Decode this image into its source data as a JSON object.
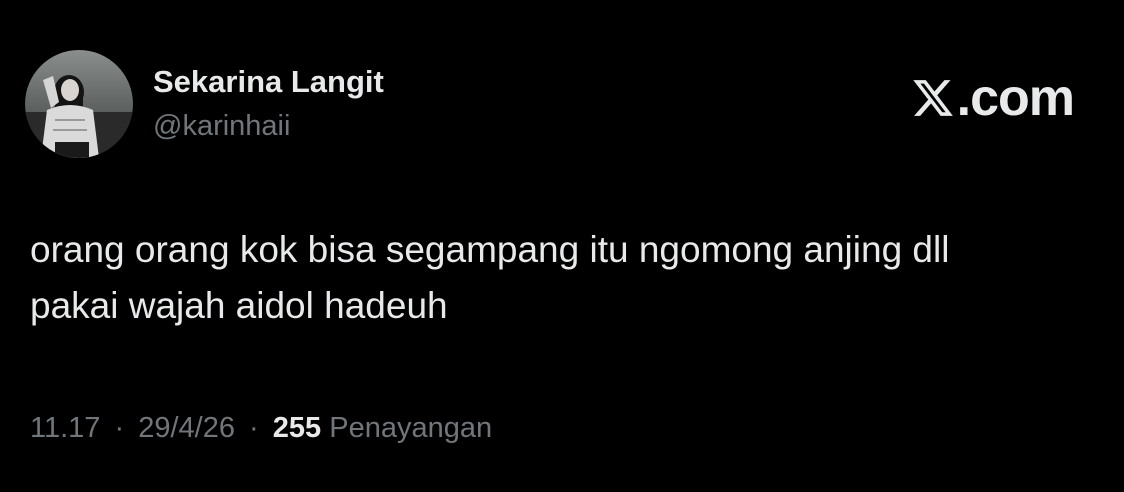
{
  "author": {
    "display_name": "Sekarina Langit",
    "handle": "@karinhaii"
  },
  "brand": {
    "logo_icon": "x-logo-icon",
    "domain": ".com"
  },
  "tweet": {
    "lines": [
      "orang orang kok bisa segampang itu ngomong anjing dll",
      "pakai wajah aidol hadeuh"
    ]
  },
  "meta": {
    "time": "11.17",
    "separator": "·",
    "date": "29/4/26",
    "views": "255",
    "views_label": "Penayangan"
  },
  "colors": {
    "background": "#000000",
    "primary_text": "#e7e9ea",
    "secondary_text": "#71767b"
  }
}
